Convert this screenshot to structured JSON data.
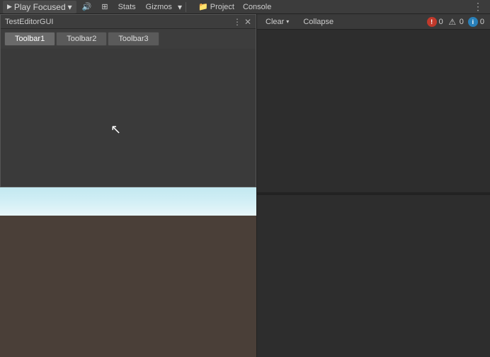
{
  "topBar": {
    "playLabel": "Play Focused",
    "playIcon": "▶",
    "dropdownIcon": "▾",
    "items": [
      {
        "id": "stats",
        "label": "Stats"
      },
      {
        "id": "gizmos",
        "label": "Gizmos"
      }
    ],
    "audioIcon": "🔊",
    "gridIcon": "⊞",
    "kebabIcon": "⋮"
  },
  "consoleTabs": [
    {
      "id": "project",
      "label": "Project",
      "icon": "📁",
      "active": false
    },
    {
      "id": "console",
      "label": "Console",
      "icon": "💬",
      "active": true
    }
  ],
  "consoleToolbar": {
    "clearLabel": "Clear",
    "clearDropdownIcon": "▾",
    "collapseLabel": "Collapse"
  },
  "consoleBadges": {
    "errorCount": "0",
    "warnCount": "0",
    "infoCount": "0"
  },
  "editorWindow": {
    "title": "TestEditorGUI",
    "controlMore": "⋮",
    "controlClose": "✕",
    "toolbarButtons": [
      {
        "id": "toolbar1",
        "label": "Toolbar1"
      },
      {
        "id": "toolbar2",
        "label": "Toolbar2"
      },
      {
        "id": "toolbar3",
        "label": "Toolbar3"
      }
    ]
  }
}
